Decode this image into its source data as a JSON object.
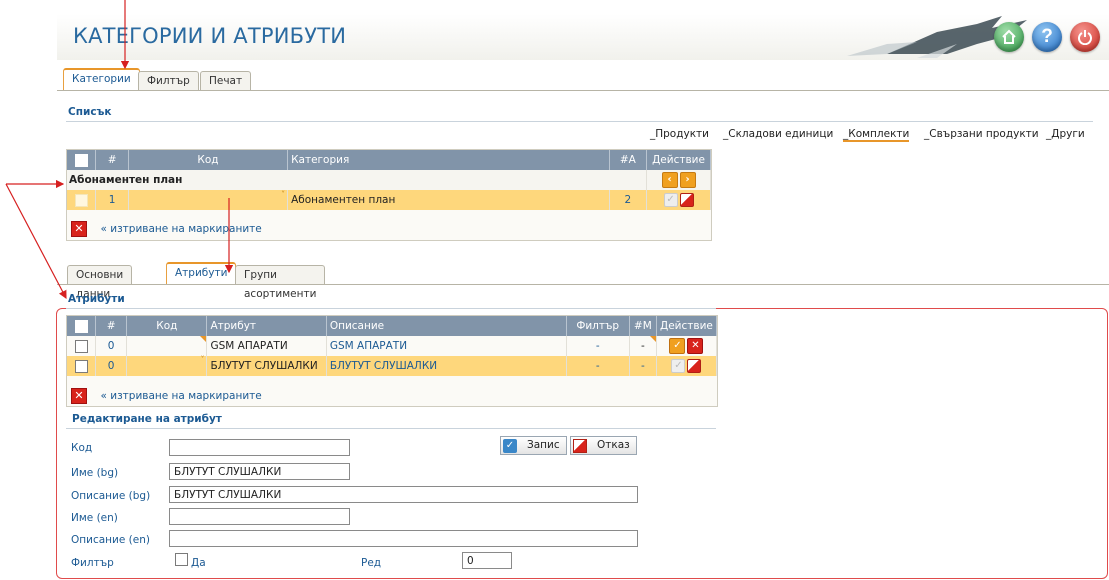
{
  "header": {
    "title": "КАТЕГОРИИ И АТРИБУТИ"
  },
  "main_tabs": [
    {
      "label": "Категории"
    },
    {
      "label": "Филтър"
    },
    {
      "label": "Печат"
    }
  ],
  "list_section": {
    "title": "Списък",
    "sub_links": [
      "_Продукти",
      "_Складови единици",
      "_Комплекти",
      "_Свързани продукти",
      "_Други"
    ],
    "columns": [
      "#",
      "Код",
      "Категория",
      "#А",
      "Действие"
    ],
    "group_row": "Абонаментен план",
    "rows": [
      {
        "num": "1",
        "code": "",
        "category": "Абонаментен план",
        "count": "2"
      }
    ],
    "delete_link": "« изтриване на маркираните"
  },
  "detail_tabs": [
    {
      "label": "Основни данни"
    },
    {
      "label": "Атрибути"
    },
    {
      "label": "Групи асортименти"
    }
  ],
  "attributes_section": {
    "title": "Атрибути",
    "columns": [
      "#",
      "Код",
      "Атрибут",
      "Описание",
      "Филтър",
      "#М",
      "Действие"
    ],
    "rows": [
      {
        "num": "0",
        "code": "",
        "attribute": "GSM АПАРАТИ",
        "description": "GSM АПАРАТИ",
        "filter": "-",
        "m": "-"
      },
      {
        "num": "0",
        "code": "",
        "attribute": "БЛУТУТ СЛУШАЛКИ",
        "description": "БЛУТУТ СЛУШАЛКИ",
        "filter": "-",
        "m": "-"
      }
    ],
    "delete_link": "« изтриване на маркираните"
  },
  "edit_form": {
    "title": "Редактиране на атрибут",
    "labels": {
      "code": "Код",
      "name_bg": "Име (bg)",
      "desc_bg": "Описание (bg)",
      "name_en": "Име (en)",
      "desc_en": "Описание (en)",
      "filter": "Филтър",
      "filter_yes": "Да",
      "order": "Ред"
    },
    "values": {
      "code": "",
      "name_bg": "БЛУТУТ СЛУШАЛКИ",
      "desc_bg": "БЛУТУТ СЛУШАЛКИ",
      "name_en": "",
      "desc_en": "",
      "order": "0"
    },
    "save_label": "Запис",
    "cancel_label": "Отказ"
  },
  "colors": {
    "accent": "#1c5a93",
    "selected_row": "#fed77c",
    "grid_header": "#8194a9",
    "annotation": "#d62020"
  }
}
